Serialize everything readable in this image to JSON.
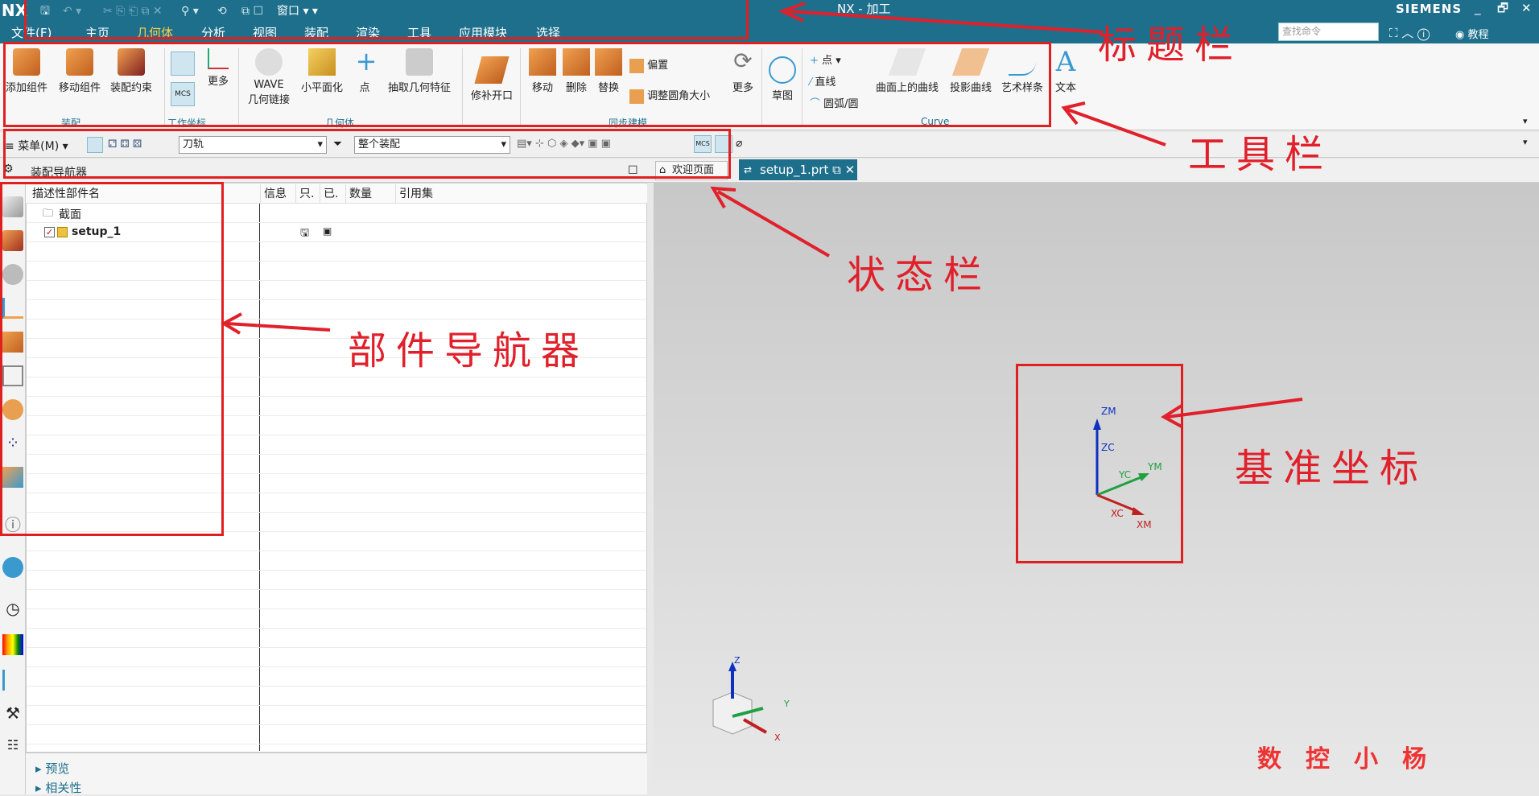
{
  "title_bar": {
    "logo": "NX",
    "window_title": "NX - 加工",
    "brand": "SIEMENS",
    "window_menu": "窗口",
    "minimize": "_",
    "restore": "🗗",
    "close": "✕"
  },
  "menu_tabs": [
    "文件(F)",
    "主页",
    "几何体",
    "分析",
    "视图",
    "装配",
    "渲染",
    "工具",
    "应用模块",
    "选择"
  ],
  "active_tab": "几何体",
  "search": {
    "placeholder": "查找命令"
  },
  "help_label": "教程",
  "ribbon": {
    "assembly": {
      "buttons": [
        "添加组件",
        "移动组件",
        "装配约束"
      ],
      "group": "装配"
    },
    "wcs": {
      "more": "更多",
      "group": "工作坐标"
    },
    "geometry": {
      "wave": "WAVE",
      "wave_sub": "几何链接",
      "flatten": "小平面化",
      "point": "点",
      "extract": "抽取几何特征",
      "group": "几何体"
    },
    "patch": "修补开口",
    "sync": {
      "buttons": [
        "移动",
        "删除",
        "替换"
      ],
      "offset": "偏置",
      "resize_blend": "调整圆角大小",
      "more": "更多",
      "group": "同步建模"
    },
    "sketch": "草图",
    "curve": {
      "point": "点",
      "line": "直线",
      "arc": "圆弧/圆",
      "on_surface": "曲面上的曲线",
      "projected": "投影曲线",
      "studio_spline": "艺术样条",
      "group": "Curve"
    },
    "text": "文本"
  },
  "toolbar2": {
    "menu": "菜单(M)",
    "filter1": "刀轨",
    "filter2": "整个装配"
  },
  "navigator": {
    "title": "装配导航器",
    "columns": [
      "描述性部件名",
      "信息",
      "只.",
      "已.",
      "数量",
      "引用集"
    ],
    "rows": [
      {
        "name": "截面"
      },
      {
        "name": "setup_1"
      }
    ],
    "bottom": [
      "预览",
      "相关性"
    ]
  },
  "tabs": {
    "welcome": "欢迎页面",
    "file": "setup_1.prt"
  },
  "triad": {
    "zm": "ZM",
    "zc": "ZC",
    "yc": "YC",
    "ym": "YM",
    "xc": "XC",
    "xm": "XM"
  },
  "view_triad": {
    "z": "Z",
    "y": "Y",
    "x": "X"
  },
  "annotations": {
    "title_bar": "标题栏",
    "toolbar": "工具栏",
    "status_bar": "状态栏",
    "part_navigator": "部件导航器",
    "datum_csys": "基准坐标"
  },
  "watermark": "数控小杨",
  "colors": {
    "teal": "#1d6f8c",
    "accent": "#ffd24a",
    "red": "#e0202a"
  }
}
